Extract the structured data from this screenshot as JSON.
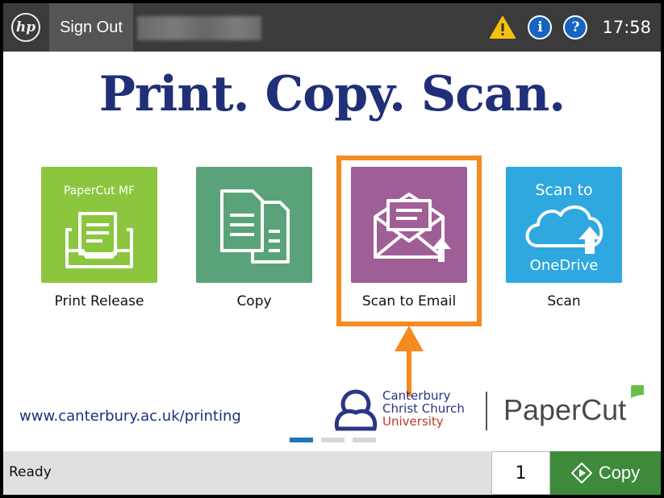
{
  "topbar": {
    "logo_text": "hp",
    "sign_out_label": "Sign Out",
    "time": "17:58",
    "icons": [
      "warning-icon",
      "info-icon",
      "help-icon"
    ],
    "info_glyph": "i",
    "help_glyph": "?"
  },
  "headline": "Print. Copy. Scan.",
  "tiles": [
    {
      "label": "Print Release",
      "icon": "print-release-icon",
      "brand_text": "PaperCut MF",
      "color": "#8cc63f"
    },
    {
      "label": "Copy",
      "icon": "copy-documents-icon",
      "color": "#5aa37a"
    },
    {
      "label": "Scan to Email",
      "icon": "email-envelope-icon",
      "color": "#a05e97",
      "highlighted": true
    },
    {
      "label": "Scan",
      "icon": "onedrive-cloud-icon",
      "caption_top": "Scan to",
      "caption_bottom": "OneDrive",
      "color": "#2ea8df"
    }
  ],
  "footer": {
    "url": "www.canterbury.ac.uk/printing",
    "university": [
      "Canterbury",
      "Christ Church",
      "University"
    ],
    "papercut_brand": "PaperCut",
    "page_indicator": {
      "count": 3,
      "active": 1
    }
  },
  "bottombar": {
    "status": "Ready",
    "copies": "1",
    "copy_label": "Copy"
  },
  "colors": {
    "accent_orange": "#f58a1f",
    "headline_blue": "#1f2f78",
    "copy_green": "#3c8a3a"
  }
}
